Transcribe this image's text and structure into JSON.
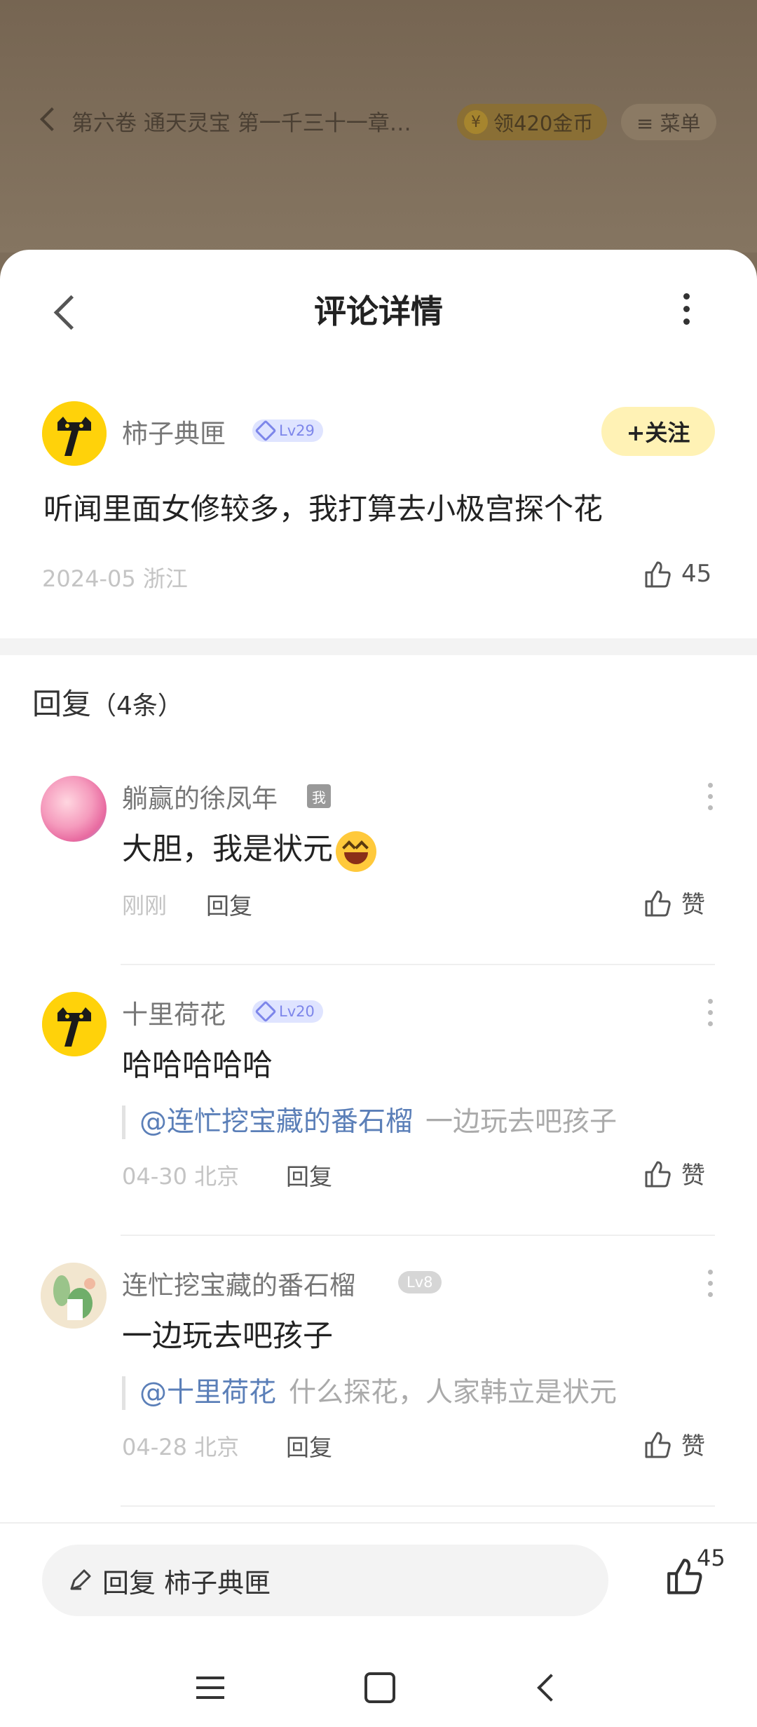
{
  "reader_bar": {
    "title": "第六卷 通天灵宝 第一千三十一章…",
    "coin_icon": "¥",
    "coin_label": "领420金币",
    "menu_label": "≡ 菜单"
  },
  "header": {
    "title": "评论详情"
  },
  "main_comment": {
    "author": "柿子典匣",
    "level": "Lv29",
    "follow_label": "+关注",
    "text": "听闻里面女修较多，我打算去小极宫探个花",
    "meta": "2024-05 浙江",
    "likes": "45"
  },
  "replies_section": {
    "title": "回复",
    "count": "（4条）"
  },
  "replies": [
    {
      "author": "躺赢的徐凤年",
      "badge": "我",
      "text": "大胆，我是状元",
      "time": "刚刚",
      "reply_label": "回复",
      "like_label": "赞"
    },
    {
      "author": "十里荷花",
      "level": "Lv20",
      "text": "哈哈哈哈哈",
      "quote_at": "@连忙挖宝藏的番石榴",
      "quote_text": "一边玩去吧孩子",
      "time": "04-30 北京",
      "reply_label": "回复",
      "like_label": "赞"
    },
    {
      "author": "连忙挖宝藏的番石榴",
      "level": "Lv8",
      "text": "一边玩去吧孩子",
      "quote_at": "@十里荷花",
      "quote_text": "什么探花，人家韩立是状元",
      "time": "04-28 北京",
      "reply_label": "回复",
      "like_label": "赞"
    }
  ],
  "bottom_bar": {
    "reply_placeholder": "回复 柿子典匣",
    "like_count": "45"
  },
  "colors": {
    "accent_yellow": "#ffd20a",
    "link_blue": "#5b7fb8",
    "follow_bg": "#fff2b5"
  }
}
